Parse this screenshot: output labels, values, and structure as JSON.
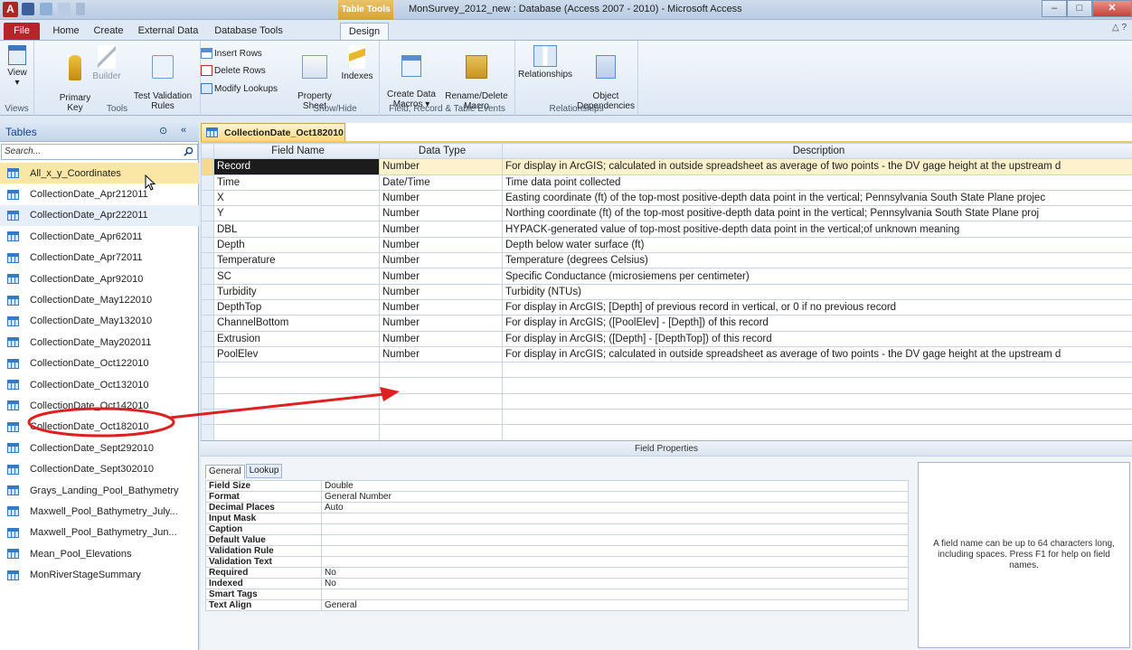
{
  "window": {
    "title": "MonSurvey_2012_new : Database (Access 2007 - 2010)  -  Microsoft Access",
    "app_letter": "A",
    "context_tab": "Table Tools",
    "help": "△ ?"
  },
  "ribbon_tabs": [
    "File",
    "Home",
    "Create",
    "External Data",
    "Database Tools",
    "Design"
  ],
  "ribbon": {
    "groups": [
      {
        "label": "Views",
        "buttons": [
          {
            "label": "View",
            "sub": "▾"
          }
        ]
      },
      {
        "label": "Tools",
        "buttons": [
          {
            "label": "Primary\nKey"
          },
          {
            "label": "Builder"
          },
          {
            "label": "Test Validation\nRules"
          }
        ],
        "small": [
          "Insert Rows",
          "Delete Rows",
          "Modify Lookups"
        ]
      },
      {
        "label": "Show/Hide",
        "buttons": [
          {
            "label": "Property\nSheet"
          },
          {
            "label": "Indexes"
          }
        ]
      },
      {
        "label": "Field, Record & Table Events",
        "buttons": [
          {
            "label": "Create Data\nMacros ▾"
          },
          {
            "label": "Rename/Delete\nMacro"
          }
        ]
      },
      {
        "label": "Relationships",
        "buttons": [
          {
            "label": "Relationships"
          },
          {
            "label": "Object\nDependencies"
          }
        ]
      }
    ]
  },
  "nav": {
    "title": "Tables",
    "search_placeholder": "Search...",
    "items": [
      "All_x_y_Coordinates",
      "CollectionDate_Apr212011",
      "CollectionDate_Apr222011",
      "CollectionDate_Apr62011",
      "CollectionDate_Apr72011",
      "CollectionDate_Apr92010",
      "CollectionDate_May122010",
      "CollectionDate_May132010",
      "CollectionDate_May202011",
      "CollectionDate_Oct122010",
      "CollectionDate_Oct132010",
      "CollectionDate_Oct142010",
      "CollectionDate_Oct182010",
      "CollectionDate_Sept292010",
      "CollectionDate_Sept302010",
      "Grays_Landing_Pool_Bathymetry",
      "Maxwell_Pool_Bathymetry_July...",
      "Maxwell_Pool_Bathymetry_Jun...",
      "Mean_Pool_Elevations",
      "MonRiverStageSummary"
    ]
  },
  "document": {
    "tab_label": "CollectionDate_Oct182010",
    "columns": [
      "Field Name",
      "Data Type",
      "Description"
    ],
    "rows": [
      [
        "Record",
        "Number",
        "For display in ArcGIS; calculated in outside spreadsheet as average of two points - the DV gage height at the upstream d"
      ],
      [
        "Time",
        "Date/Time",
        "Time data point collected"
      ],
      [
        "X",
        "Number",
        "Easting coordinate (ft) of the top-most positive-depth data point in the vertical; Pennsylvania South State Plane projec"
      ],
      [
        "Y",
        "Number",
        "Northing coordinate (ft) of the top-most positive-depth data point in the vertical; Pennsylvania South State Plane proj"
      ],
      [
        "DBL",
        "Number",
        "HYPACK-generated value of top-most positive-depth data point in the vertical;of unknown meaning"
      ],
      [
        "Depth",
        "Number",
        "Depth below water surface (ft)"
      ],
      [
        "Temperature",
        "Number",
        "Temperature (degrees Celsius)"
      ],
      [
        "SC",
        "Number",
        "Specific Conductance (microsiemens per centimeter)"
      ],
      [
        "Turbidity",
        "Number",
        "Turbidity (NTUs)"
      ],
      [
        "DepthTop",
        "Number",
        "For display in ArcGIS; [Depth] of previous record in vertical, or 0 if no previous record"
      ],
      [
        "ChannelBottom",
        "Number",
        "For display in ArcGIS; ([PoolElev] - [Depth]) of this record"
      ],
      [
        "Extrusion",
        "Number",
        "For display in ArcGIS; ([Depth] - [DepthTop]) of this record"
      ],
      [
        "PoolElev",
        "Number",
        "For display in ArcGIS; calculated in outside spreadsheet as average of two points - the DV gage height at the upstream d"
      ]
    ]
  },
  "field_properties": {
    "title": "Field Properties",
    "tabs": [
      "General",
      "Lookup"
    ],
    "rows": [
      [
        "Field Size",
        "Double"
      ],
      [
        "Format",
        "General Number"
      ],
      [
        "Decimal Places",
        "Auto"
      ],
      [
        "Input Mask",
        ""
      ],
      [
        "Caption",
        ""
      ],
      [
        "Default Value",
        ""
      ],
      [
        "Validation Rule",
        ""
      ],
      [
        "Validation Text",
        ""
      ],
      [
        "Required",
        "No"
      ],
      [
        "Indexed",
        "No"
      ],
      [
        "Smart Tags",
        ""
      ],
      [
        "Text Align",
        "General"
      ]
    ],
    "help_text": "A field name can be up to 64 characters long, including spaces. Press F1 for help on field names."
  },
  "colors": {
    "annotation": "#e02020",
    "selected_nav": "#fbe7a5",
    "file_tab": "#b5252a"
  }
}
